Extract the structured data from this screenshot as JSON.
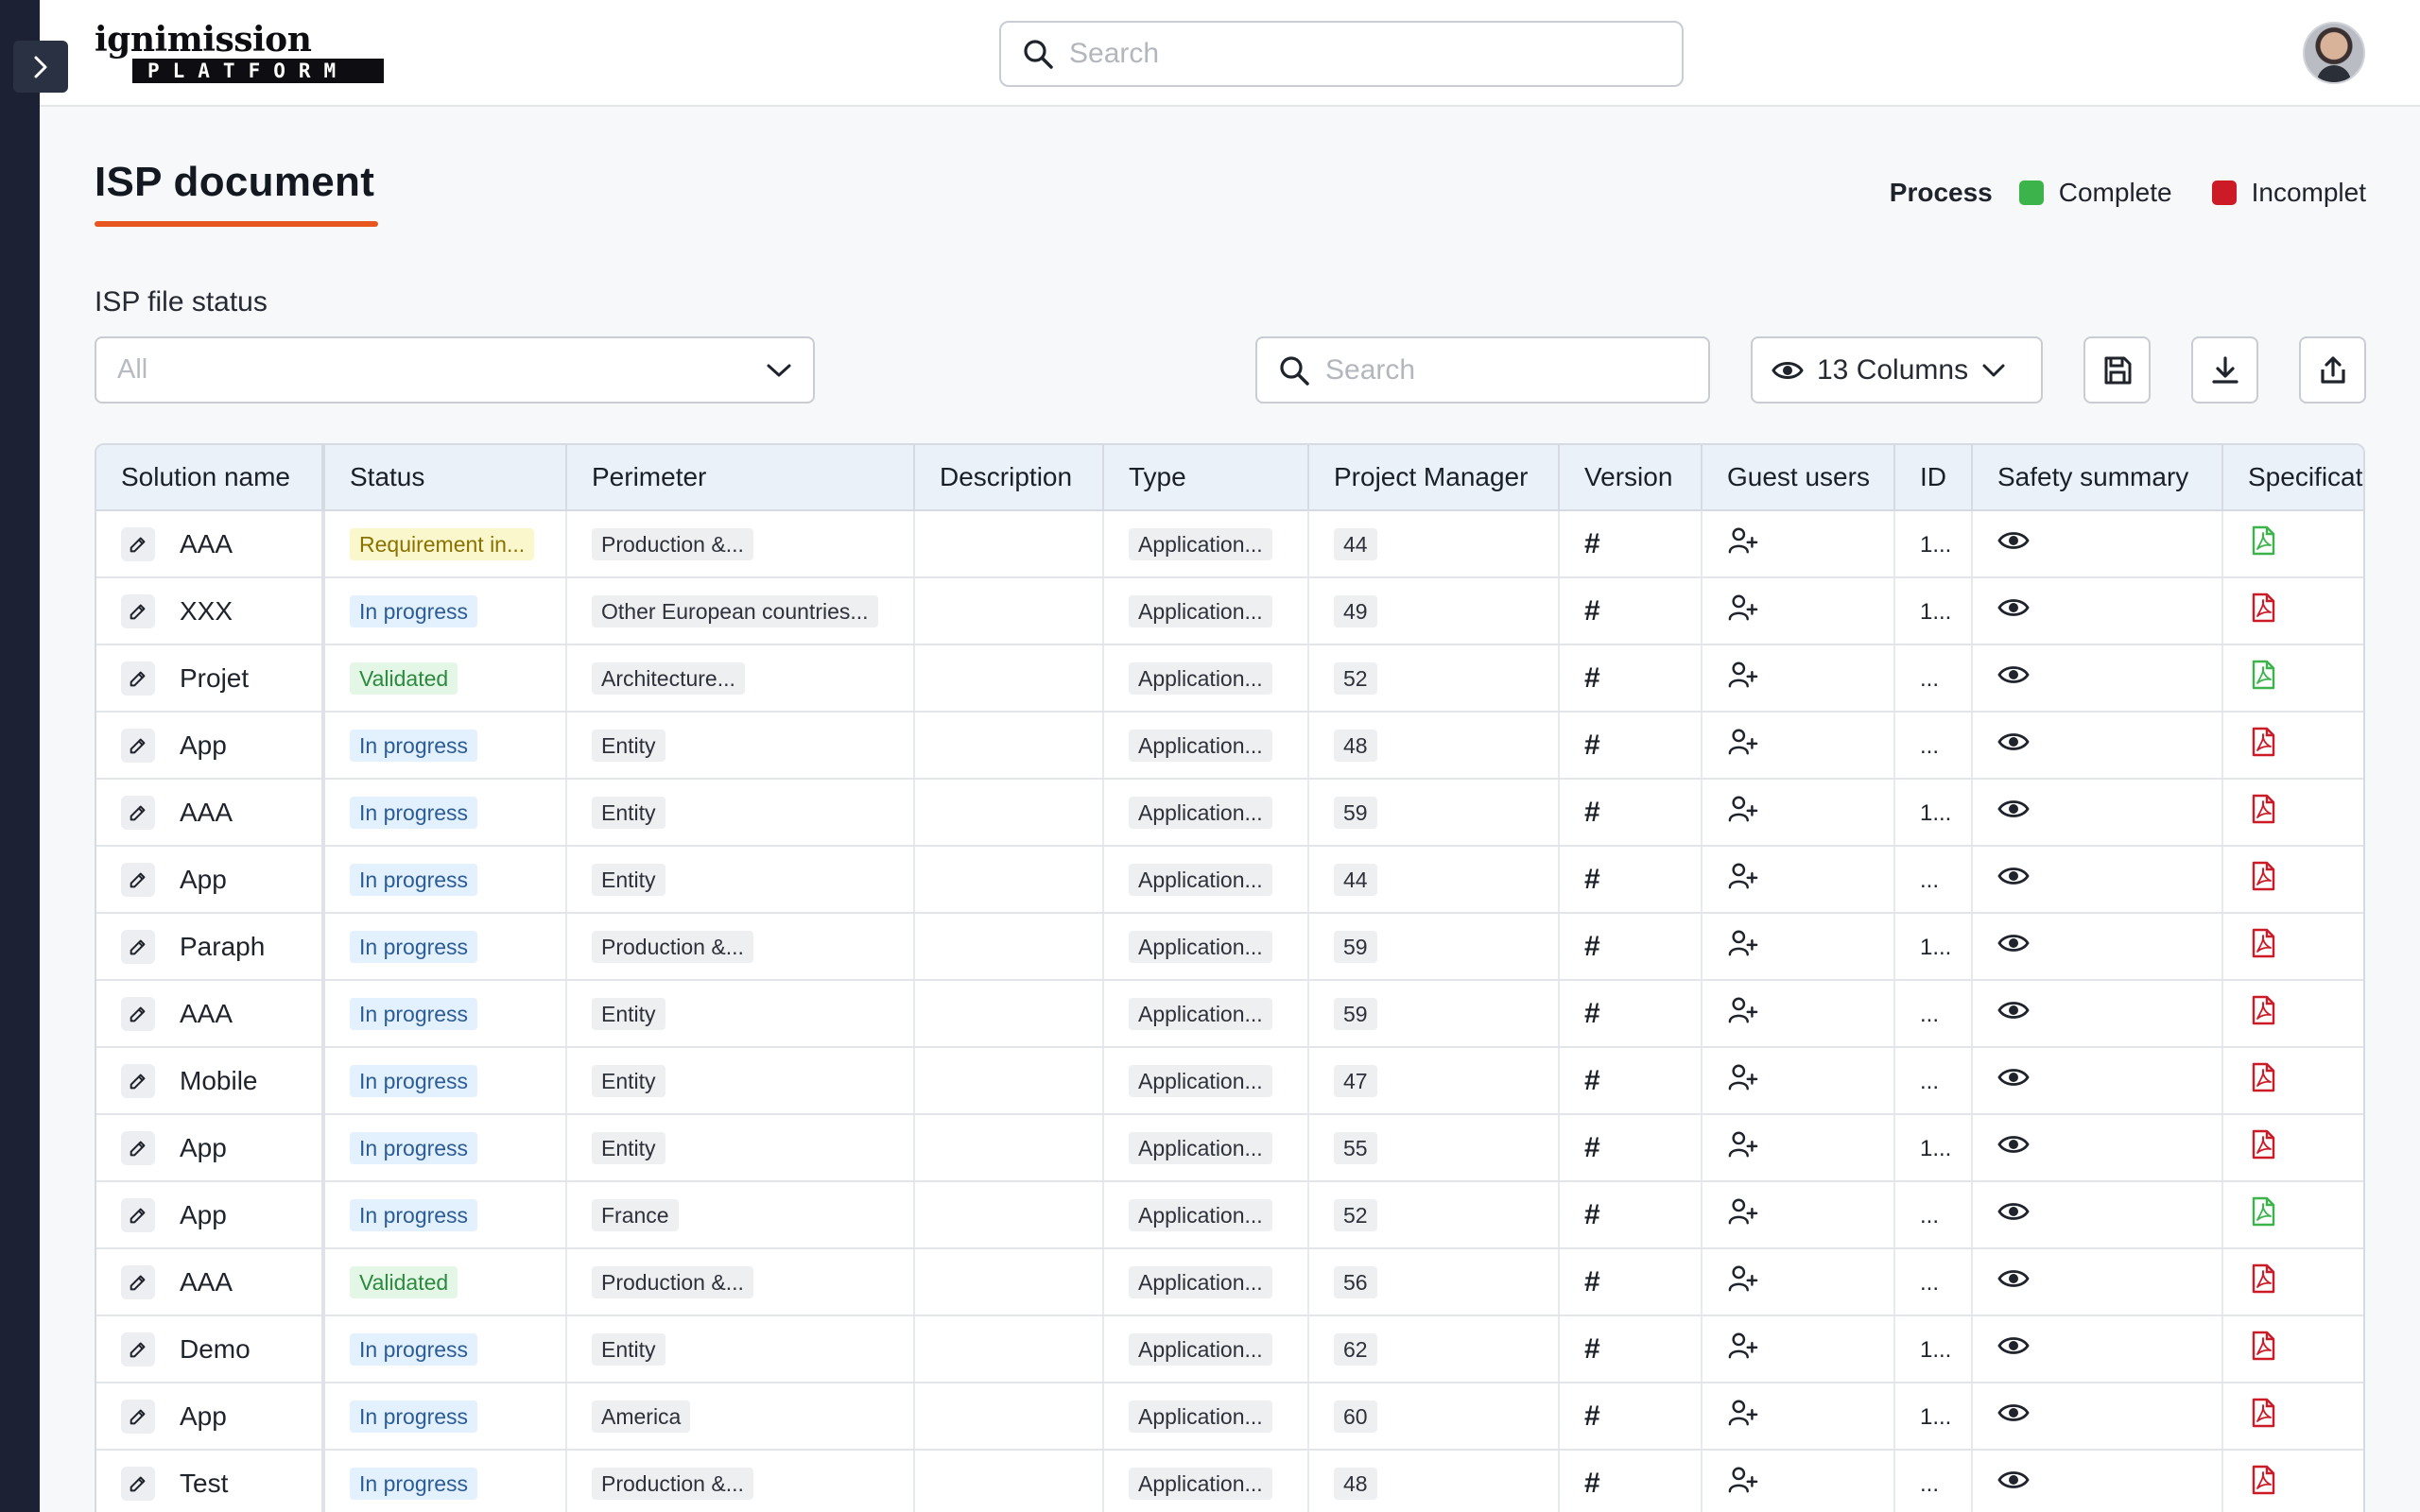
{
  "app": {
    "logo_top": "ignimission",
    "logo_bottom": "PLATFORM",
    "search_placeholder": "Search"
  },
  "page": {
    "title": "ISP document",
    "legend": {
      "title": "Process",
      "items": [
        {
          "label": "Complete",
          "color": "#3cb44b"
        },
        {
          "label": "Incomplet",
          "color": "#cc1b26"
        }
      ]
    },
    "filter": {
      "label": "ISP file status",
      "value": "All"
    },
    "toolbar": {
      "search_placeholder": "Search",
      "columns_label": "13 Columns"
    }
  },
  "colors": {
    "accent": "#e8561f",
    "complete": "#3cb44b",
    "incomplete": "#cc1b26",
    "status_blue_bg": "#e3f0fd",
    "status_green_bg": "#e4f6e6",
    "status_yellow_bg": "#fbf7cc"
  },
  "table": {
    "columns": [
      "Solution name",
      "Status",
      "Perimeter",
      "Description",
      "Type",
      "Project Manager",
      "Version",
      "Guest users",
      "ID",
      "Safety summary",
      "Specificat"
    ],
    "rows": [
      {
        "name": "AAA",
        "status": "Requirement in...",
        "status_kind": "yellow",
        "perimeter": "Production &...",
        "type": "Application...",
        "pm": "44",
        "version": "#",
        "id": "1...",
        "spec": "complete"
      },
      {
        "name": "XXX",
        "status": "In progress",
        "status_kind": "blue",
        "perimeter": "Other European countries...",
        "type": "Application...",
        "pm": "49",
        "version": "#",
        "id": "1...",
        "spec": "incomplete"
      },
      {
        "name": "Projet",
        "status": "Validated",
        "status_kind": "green",
        "perimeter": "Architecture...",
        "type": "Application...",
        "pm": "52",
        "version": "#",
        "id": "...",
        "spec": "complete"
      },
      {
        "name": "App",
        "status": "In progress",
        "status_kind": "blue",
        "perimeter": "Entity",
        "type": "Application...",
        "pm": "48",
        "version": "#",
        "id": "...",
        "spec": "incomplete"
      },
      {
        "name": "AAA",
        "status": "In progress",
        "status_kind": "blue",
        "perimeter": "Entity",
        "type": "Application...",
        "pm": "59",
        "version": "#",
        "id": "1...",
        "spec": "incomplete"
      },
      {
        "name": "App",
        "status": "In progress",
        "status_kind": "blue",
        "perimeter": "Entity",
        "type": "Application...",
        "pm": "44",
        "version": "#",
        "id": "...",
        "spec": "incomplete"
      },
      {
        "name": "Paraph",
        "status": "In progress",
        "status_kind": "blue",
        "perimeter": "Production &...",
        "type": "Application...",
        "pm": "59",
        "version": "#",
        "id": "1...",
        "spec": "incomplete"
      },
      {
        "name": "AAA",
        "status": "In progress",
        "status_kind": "blue",
        "perimeter": "Entity",
        "type": "Application...",
        "pm": "59",
        "version": "#",
        "id": "...",
        "spec": "incomplete"
      },
      {
        "name": "Mobile",
        "status": "In progress",
        "status_kind": "blue",
        "perimeter": "Entity",
        "type": "Application...",
        "pm": "47",
        "version": "#",
        "id": "...",
        "spec": "incomplete"
      },
      {
        "name": "App",
        "status": "In progress",
        "status_kind": "blue",
        "perimeter": "Entity",
        "type": "Application...",
        "pm": "55",
        "version": "#",
        "id": "1...",
        "spec": "incomplete"
      },
      {
        "name": "App",
        "status": "In progress",
        "status_kind": "blue",
        "perimeter": "France",
        "type": "Application...",
        "pm": "52",
        "version": "#",
        "id": "...",
        "spec": "complete"
      },
      {
        "name": "AAA",
        "status": "Validated",
        "status_kind": "green",
        "perimeter": "Production &...",
        "type": "Application...",
        "pm": "56",
        "version": "#",
        "id": "...",
        "spec": "incomplete"
      },
      {
        "name": "Demo",
        "status": "In progress",
        "status_kind": "blue",
        "perimeter": "Entity",
        "type": "Application...",
        "pm": "62",
        "version": "#",
        "id": "1...",
        "spec": "incomplete"
      },
      {
        "name": "App",
        "status": "In progress",
        "status_kind": "blue",
        "perimeter": "America",
        "type": "Application...",
        "pm": "60",
        "version": "#",
        "id": "1...",
        "spec": "incomplete"
      },
      {
        "name": "Test",
        "status": "In progress",
        "status_kind": "blue",
        "perimeter": "Production &...",
        "type": "Application...",
        "pm": "48",
        "version": "#",
        "id": "...",
        "spec": "incomplete"
      }
    ]
  },
  "icons": {
    "sidebar_toggle": "chevron-right-icon",
    "search": "search-icon",
    "filter_dropdown": "chevron-down-icon",
    "columns": "eye-icon",
    "save": "save-icon",
    "download": "download-icon",
    "export": "share-icon",
    "edit": "pencil-icon",
    "guest": "user-plus-icon",
    "safety": "eye-icon",
    "spec": "pdf-file-icon"
  }
}
